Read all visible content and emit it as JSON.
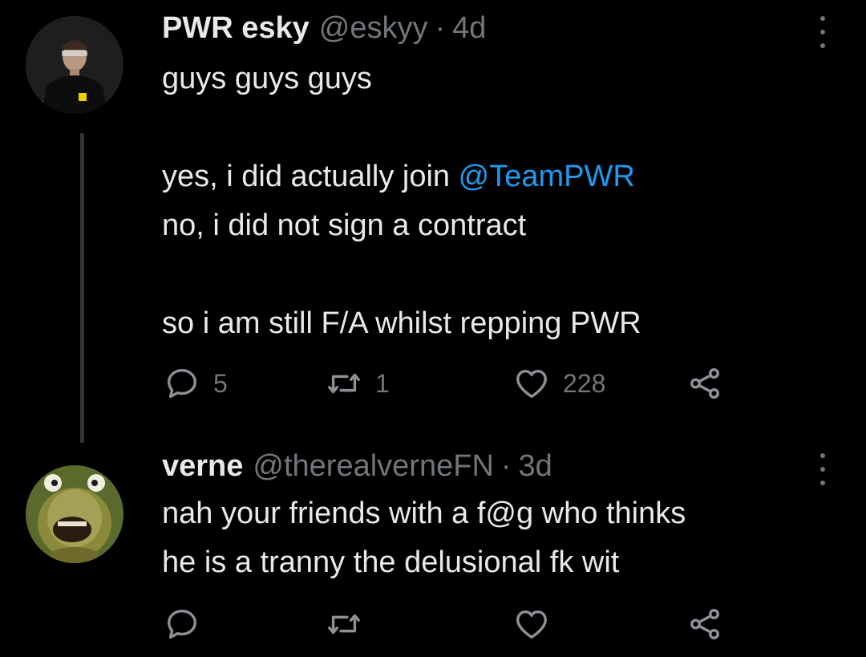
{
  "tweets": [
    {
      "display_name": "PWR esky",
      "handle": "@eskyy",
      "separator": "·",
      "time": "4d",
      "lines": [
        "guys guys guys",
        "",
        "yes, i did actually join ",
        "no, i did not sign a contract",
        "",
        "so i am still F/A whilst repping PWR"
      ],
      "line1": "guys guys guys",
      "line2_pre": "yes, i did actually join ",
      "line2_mention": "@TeamPWR",
      "line3": "no, i did not sign a contract",
      "line4": "so i am still F/A whilst repping PWR",
      "replies": "5",
      "retweets": "1",
      "likes": "228"
    },
    {
      "display_name": "verne",
      "handle": "@therealverneFN",
      "separator": "·",
      "time": "3d",
      "line1": "nah your friends with a f@g who thinks",
      "line2": "he is a tranny the delusional fk wit"
    }
  ],
  "colors": {
    "background": "#000000",
    "text": "#e7e9ea",
    "secondary": "#71767b",
    "mention": "#1d9bf0"
  },
  "icons": [
    "reply-icon",
    "retweet-icon",
    "like-icon",
    "share-icon",
    "more-icon"
  ]
}
